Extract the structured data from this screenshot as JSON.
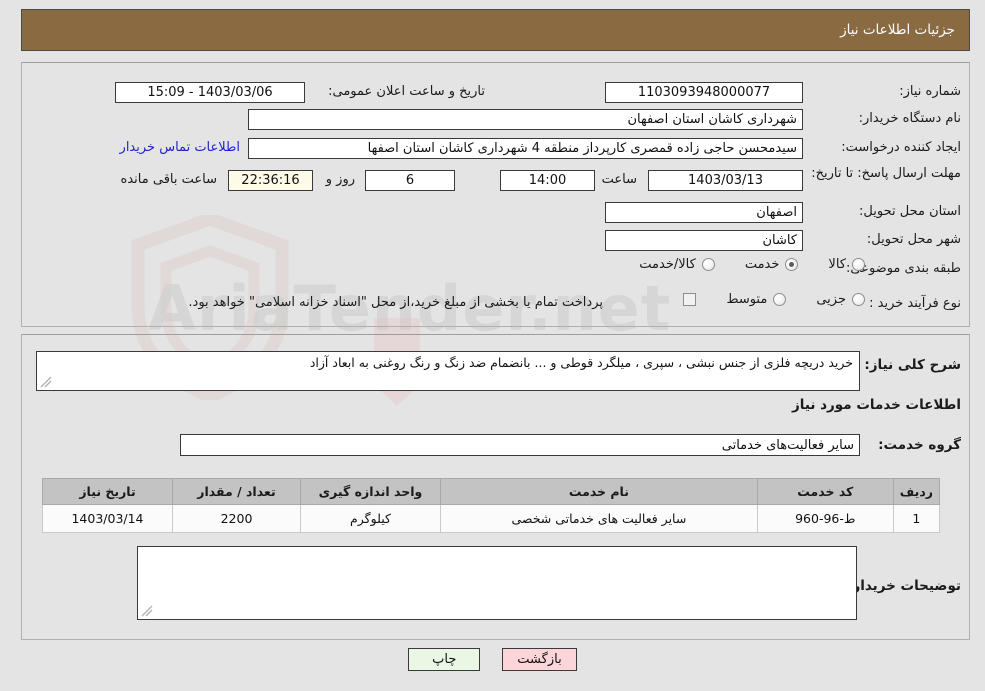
{
  "header": {
    "title": "جزئیات اطلاعات نیاز"
  },
  "watermark": {
    "text": "AriaTender.net",
    "shield_icon": "shield-icon",
    "arrow_icon": "down-arrow-icon"
  },
  "form": {
    "need_number": {
      "label": "شماره نیاز:",
      "value": "1103093948000077"
    },
    "announce_datetime": {
      "label": "تاریخ و ساعت اعلان عمومی:",
      "value": "15:09 - 1403/03/06"
    },
    "buyer_org": {
      "label": "نام دستگاه خریدار:",
      "value": "شهرداری کاشان استان اصفهان"
    },
    "requester": {
      "label": "ایجاد کننده درخواست:",
      "value": "سیدمحسن حاجی زاده قمصری کارپرداز منطقه 4 شهرداری کاشان استان اصفها"
    },
    "contact_link": {
      "label": "اطلاعات تماس خریدار"
    },
    "response_deadline": {
      "label": "مهلت ارسال پاسخ: تا تاریخ:",
      "date": "1403/03/13",
      "hour_label": "ساعت",
      "hour": "14:00",
      "days": "6",
      "day_and_label": "روز و",
      "remaining": "22:36:16",
      "remaining_label": "ساعت باقی مانده"
    },
    "province": {
      "label": "استان محل تحویل:",
      "value": "اصفهان"
    },
    "city": {
      "label": "شهر محل تحویل:",
      "value": "کاشان"
    },
    "category": {
      "label": "طبقه بندی موضوعی:",
      "options": [
        {
          "label": "کالا",
          "selected": false
        },
        {
          "label": "خدمت",
          "selected": true
        },
        {
          "label": "کالا/خدمت",
          "selected": false
        }
      ]
    },
    "purchase_process": {
      "label": "نوع فرآیند خرید :",
      "options": [
        {
          "label": "جزیی",
          "selected": false
        },
        {
          "label": "متوسط",
          "selected": false
        }
      ],
      "checkbox_label": "",
      "note": "پرداخت تمام یا بخشی از مبلغ خرید،از محل \"اسناد خزانه اسلامی\" خواهد بود."
    },
    "general_description": {
      "label": "شرح کلی نیاز:",
      "value": "خرید دریچه فلزی از جنس نبشی ، سپری ، میلگرد قوطی و ... بانضمام ضد زنگ و رنگ روغنی به ابعاد آزاد"
    },
    "services_heading": "اطلاعات خدمات مورد نیاز",
    "service_group": {
      "label": "گروه خدمت:",
      "value": "سایر فعالیت‌های خدماتی"
    },
    "buyer_notes": {
      "label": "توضیحات خریدار:",
      "value": ""
    }
  },
  "table": {
    "headers": [
      "ردیف",
      "کد خدمت",
      "نام خدمت",
      "واحد اندازه گیری",
      "تعداد / مقدار",
      "تاریخ نیاز"
    ],
    "rows": [
      {
        "row_no": "1",
        "service_code": "ط-96-960",
        "service_name": "سایر فعالیت های خدماتی شخصی",
        "unit": "کیلوگرم",
        "quantity": "2200",
        "need_date": "1403/03/14"
      }
    ]
  },
  "buttons": {
    "back": "بازگشت",
    "print": "چاپ"
  },
  "colors": {
    "header_bar": "#8a6b41",
    "page_background": "#e4e4e4",
    "link": "#2222cc",
    "back_button": "#fbd5d8",
    "print_button": "#e9f7e4",
    "table_header": "#c3c3c3"
  }
}
